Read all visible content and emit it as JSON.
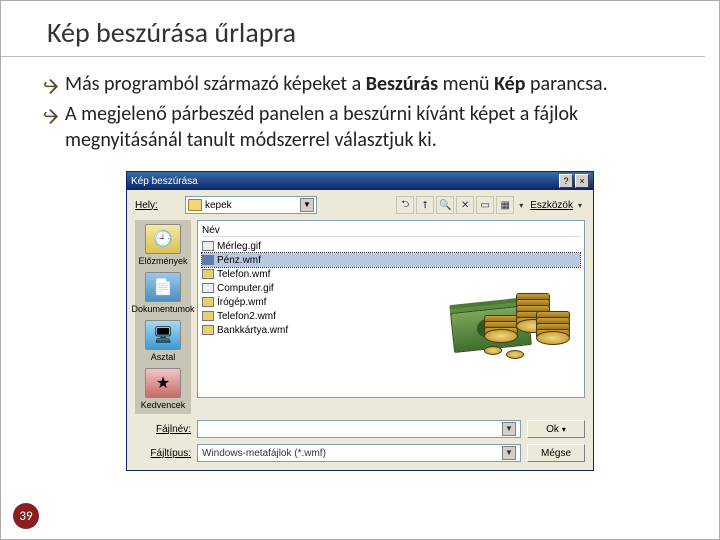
{
  "slide": {
    "title": "Kép beszúrása űrlapra",
    "page_number": "39"
  },
  "bullets": {
    "b1": {
      "pre": "Más programból származó képeket a ",
      "bold1": "Beszúrás",
      "mid": " menü ",
      "bold2": "Kép",
      "post": " parancsa."
    },
    "b2": "A megjelenő párbeszéd panelen a beszúrni kívánt képet a fájlok megnyitásánál tanult módszerrel választjuk ki."
  },
  "dialog": {
    "title": "Kép beszúrása",
    "location_label": "Hely:",
    "folder_name": "kepek",
    "tools_label": "Eszközök",
    "places": [
      {
        "label": "Előzmények"
      },
      {
        "label": "Dokumentumok"
      },
      {
        "label": "Asztal"
      },
      {
        "label": "Kedvencek"
      }
    ],
    "file_header": "Név",
    "files": [
      {
        "name": "Mérleg.gif",
        "sel": false
      },
      {
        "name": "Pénz.wmf",
        "sel": true
      },
      {
        "name": "Telefon.wmf",
        "sel": false
      },
      {
        "name": "Computer.gif",
        "sel": false
      },
      {
        "name": "Írógép.wmf",
        "sel": false
      },
      {
        "name": "Telefon2.wmf",
        "sel": false
      },
      {
        "name": "Bankkártya.wmf",
        "sel": false
      }
    ],
    "filename_label": "Fájlnév:",
    "filename_value": "",
    "filetype_label": "Fájltípus:",
    "filetype_value": "Windows-metafájlok (*.wmf)",
    "ok_label": "Ok",
    "cancel_label": "Mégse"
  }
}
